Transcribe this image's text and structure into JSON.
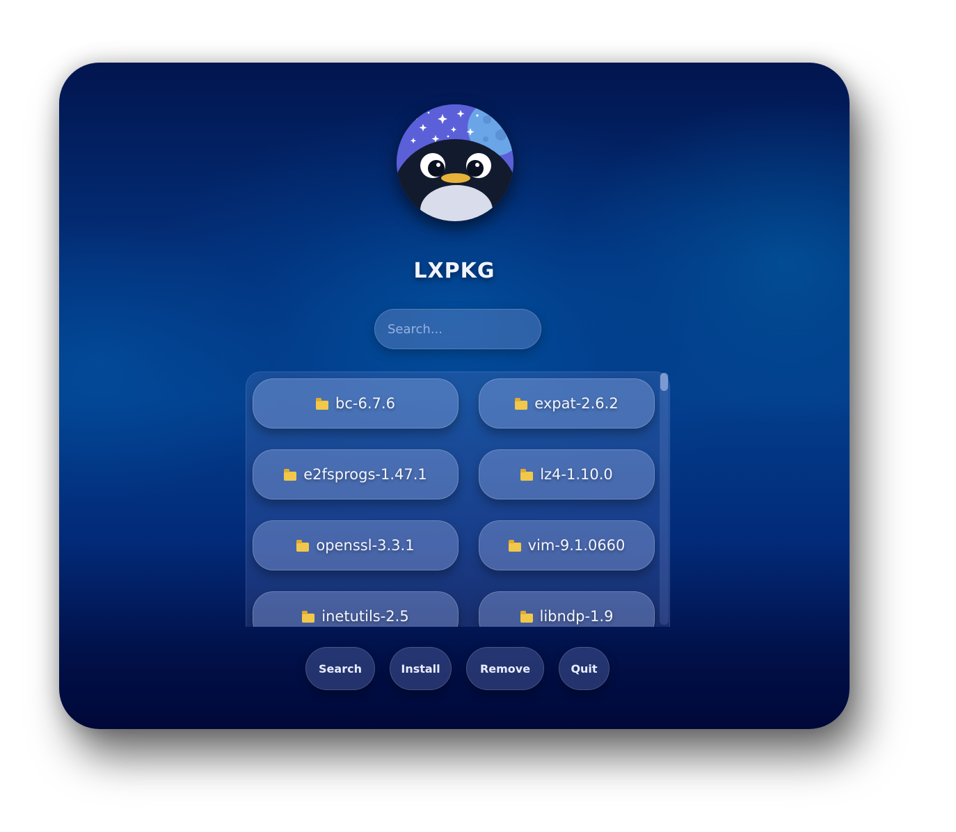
{
  "app": {
    "title": "LXPKG"
  },
  "search": {
    "placeholder": "Search..."
  },
  "packages": [
    {
      "label": "bc-6.7.6",
      "icon": "folder-icon"
    },
    {
      "label": "expat-2.6.2",
      "icon": "folder-icon"
    },
    {
      "label": "e2fsprogs-1.47.1",
      "icon": "folder-icon"
    },
    {
      "label": "lz4-1.10.0",
      "icon": "folder-icon"
    },
    {
      "label": "openssl-3.3.1",
      "icon": "folder-icon"
    },
    {
      "label": "vim-9.1.0660",
      "icon": "folder-icon"
    },
    {
      "label": "inetutils-2.5",
      "icon": "folder-icon"
    },
    {
      "label": "libndp-1.9",
      "icon": "folder-icon"
    }
  ],
  "actions": {
    "search_label": "Search",
    "install_label": "Install",
    "remove_label": "Remove",
    "quit_label": "Quit"
  },
  "colors": {
    "background_top": "#02154f",
    "background_mid": "#033e8c",
    "background_bottom": "#000838",
    "folder": "#f2c84b"
  }
}
